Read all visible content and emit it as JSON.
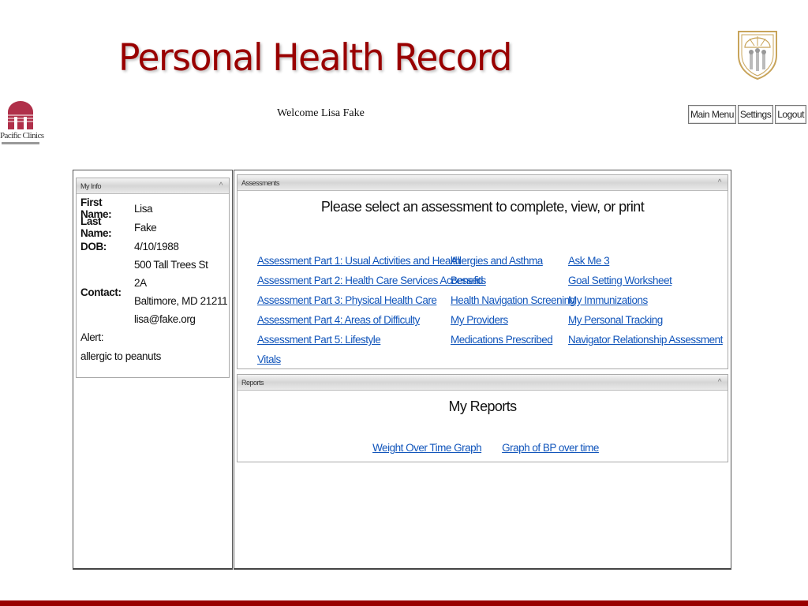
{
  "slide": {
    "title": "Personal Health Record",
    "accent_color": "#990000"
  },
  "logos": {
    "left": {
      "name": "Pacific Clinics",
      "icon": "pacific-clinics-logo"
    },
    "right": {
      "icon": "usc-seal-logo"
    }
  },
  "header": {
    "welcome": "Welcome Lisa Fake",
    "buttons": [
      "Main Menu",
      "Settings",
      "Logout"
    ]
  },
  "my_info": {
    "title": "My Info",
    "collapse_glyph": "^",
    "first_name_label": "First Name:",
    "first_name": "Lisa",
    "last_name_label": "Last Name:",
    "last_name": "Fake",
    "dob_label": "DOB:",
    "dob": "4/10/1988",
    "contact_label": "Contact:",
    "contact": [
      "500 Tall Trees St",
      "2A",
      "Baltimore, MD 21211",
      "lisa@fake.org"
    ],
    "alert_label": "Alert:",
    "alert": "allergic to peanuts"
  },
  "assessments": {
    "title": "Assessments",
    "collapse_glyph": "^",
    "heading": "Please select an assessment to complete, view, or print",
    "columns": [
      [
        "Assessment Part 1: Usual Activities and Health",
        "Assessment Part 2: Health Care Services Accessed",
        "Assessment Part 3: Physical Health Care",
        "Assessment Part 4: Areas of Difficulty",
        "Assessment Part 5: Lifestyle",
        "Vitals"
      ],
      [
        "Allergies and Asthma",
        "Benefits",
        "Health Navigation Screening",
        "My Providers",
        "Medications Prescribed"
      ],
      [
        "Ask Me 3",
        "Goal Setting Worksheet",
        "My Immunizations",
        "My Personal Tracking",
        "Navigator Relationship Assessment"
      ]
    ],
    "link_color": "#1155bb"
  },
  "reports": {
    "title": "Reports",
    "collapse_glyph": "^",
    "heading": "My Reports",
    "links": [
      "Weight Over Time Graph",
      "Graph of BP over time"
    ]
  }
}
